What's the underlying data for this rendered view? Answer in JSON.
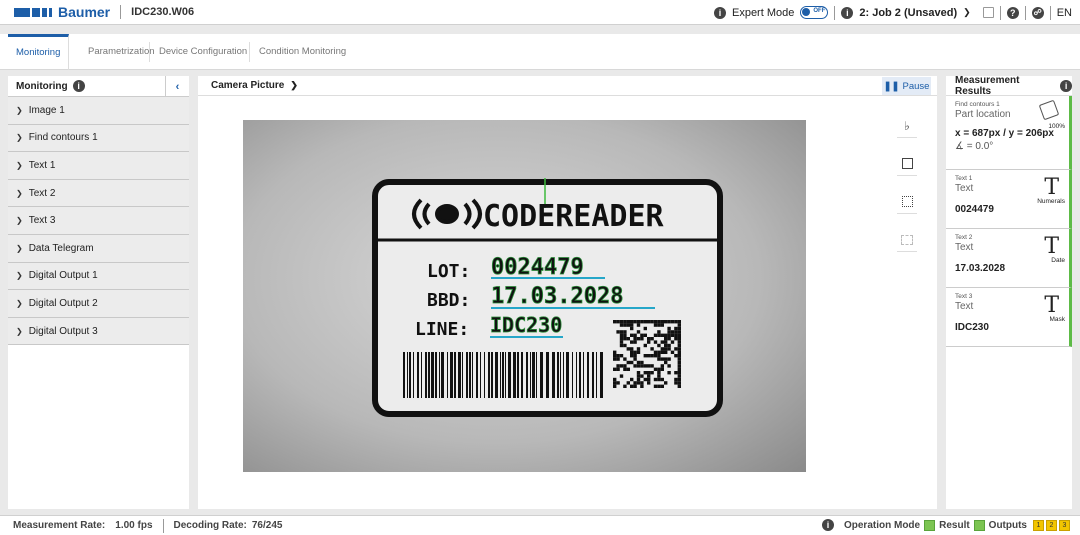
{
  "app": {
    "brand": "Baumer",
    "device": "IDC230.W06",
    "expert_mode_label": "Expert Mode",
    "toggle_state": "OFF",
    "job_label": "2: Job 2 (Unsaved)",
    "language": "EN"
  },
  "tabs": [
    {
      "label": "Monitoring",
      "active": true
    },
    {
      "label": "Parametrization",
      "active": false
    },
    {
      "label": "Device Configuration",
      "active": false
    },
    {
      "label": "Condition Monitoring",
      "active": false
    }
  ],
  "left": {
    "title": "Monitoring",
    "collapse": "‹",
    "items": [
      "Image 1",
      "Find contours 1",
      "Text 1",
      "Text 2",
      "Text 3",
      "Data Telegram",
      "Digital Output 1",
      "Digital Output 2",
      "Digital Output 3"
    ]
  },
  "center": {
    "title": "Camera Picture",
    "pause_label": "Pause",
    "label_text": {
      "brand": "CODEREADER",
      "lot_key": "LOT:",
      "lot_val": "0024479",
      "bbd_key": "BBD:",
      "bbd_val": "17.03.2028",
      "line_key": "LINE:",
      "line_val": "IDC230"
    }
  },
  "right": {
    "title": "Measurement Results",
    "cards": [
      {
        "name": "Find contours 1",
        "type": "Part location",
        "sub": "100%",
        "value": "x = 687px / y = 206px",
        "value2": "∡ = 0.0°",
        "icon": "part-location-icon"
      },
      {
        "name": "Text 1",
        "type": "Text",
        "sub": "Numerals",
        "value": "0024479",
        "icon": "text-icon"
      },
      {
        "name": "Text 2",
        "type": "Text",
        "sub": "Date",
        "value": "17.03.2028",
        "icon": "text-icon"
      },
      {
        "name": "Text 3",
        "type": "Text",
        "sub": "Mask",
        "value": "IDC230",
        "icon": "text-icon"
      }
    ]
  },
  "status": {
    "rate_label": "Measurement Rate:",
    "rate_value": "1.00 fps",
    "decode_label": "Decoding Rate:",
    "decode_value": "76/245",
    "op_mode_label": "Operation Mode",
    "result_label": "Result",
    "outputs_label": "Outputs",
    "outputs": [
      "1",
      "2",
      "3"
    ]
  },
  "colors": {
    "accent": "#1d5ea8",
    "ok": "#7cc552",
    "output": "#f2c500",
    "ocr_box": "#2c8f3a",
    "ocr_underline": "#26a7c9"
  }
}
